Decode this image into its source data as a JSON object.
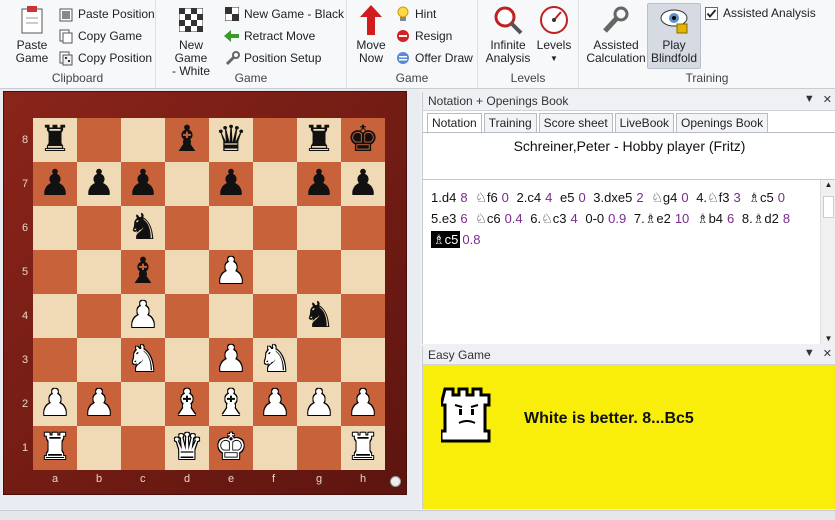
{
  "ribbon": {
    "clipboard": {
      "label": "Clipboard",
      "paste_game": "Paste\nGame",
      "paste_position": "Paste Position",
      "copy_game": "Copy Game",
      "copy_position": "Copy Position"
    },
    "game": {
      "label": "Game",
      "new_game_white": "New Game\n- White",
      "new_game_black": "New Game - Black",
      "retract_move": "Retract Move",
      "position_setup": "Position Setup"
    },
    "game2": {
      "label": "Game",
      "move_now": "Move\nNow",
      "hint": "Hint",
      "resign": "Resign",
      "offer_draw": "Offer Draw"
    },
    "levels": {
      "label": "Levels",
      "infinite_analysis": "Infinite\nAnalysis",
      "levels": "Levels"
    },
    "training": {
      "label": "Training",
      "assisted_calculation": "Assisted\nCalculation",
      "play_blindfold": "Play\nBlindfold",
      "assisted_analysis": "Assisted Analysis",
      "assisted_analysis_checked": true
    }
  },
  "board": {
    "files": [
      "a",
      "b",
      "c",
      "d",
      "e",
      "f",
      "g",
      "h"
    ],
    "ranks": [
      "8",
      "7",
      "6",
      "5",
      "4",
      "3",
      "2",
      "1"
    ],
    "rows": [
      [
        "bR",
        "",
        "",
        "bB",
        "bQ",
        "",
        "bR",
        "bK",
        ""
      ],
      [
        "bP",
        "bP",
        "bP",
        "",
        "bP",
        "",
        "bP",
        "bP",
        ""
      ],
      [
        "",
        "",
        "bN",
        "",
        "",
        "",
        "",
        ""
      ],
      [
        "",
        "",
        "bB",
        "",
        "wP",
        "",
        "",
        ""
      ],
      [
        "",
        "",
        "wP",
        "",
        "",
        "",
        "bN",
        ""
      ],
      [
        "",
        "",
        "wN",
        "",
        "wP",
        "wN",
        "",
        ""
      ],
      [
        "wP",
        "wP",
        "",
        "wB",
        "wB",
        "wP",
        "wP",
        "wP"
      ],
      [
        "wR",
        "",
        "",
        "wQ",
        "wK",
        "",
        "",
        "wR"
      ]
    ]
  },
  "notation": {
    "title": "Notation + Openings Book",
    "tabs": [
      "Notation",
      "Training",
      "Score sheet",
      "LiveBook",
      "Openings Book"
    ],
    "active_tab": "Notation",
    "game_header": "Schreiner,Peter - Hobby player (Fritz)",
    "moves": [
      {
        "m": "1.d4",
        "e": "8"
      },
      {
        "m": "♘f6",
        "e": "0"
      },
      {
        "m": "2.c4",
        "e": "4"
      },
      {
        "m": "e5",
        "e": "0"
      },
      {
        "m": "3.dxe5",
        "e": "2"
      },
      {
        "m": "♘g4",
        "e": "0"
      },
      {
        "m": "4.♘f3",
        "e": "3"
      },
      {
        "m": "♗c5",
        "e": "0"
      },
      {
        "m": "5.e3",
        "e": "6"
      },
      {
        "m": "♘c6",
        "e": "0.4"
      },
      {
        "m": "6.♘c3",
        "e": "4"
      },
      {
        "m": "0-0",
        "e": "0.9"
      },
      {
        "m": "7.♗e2",
        "e": "10"
      },
      {
        "m": "♗b4",
        "e": "6"
      },
      {
        "m": "8.♗d2",
        "e": "8"
      },
      {
        "m": "♗c5",
        "e": "0.8",
        "current": true
      }
    ]
  },
  "easy_game": {
    "title": "Easy Game",
    "message": "White is better.  8...Bc5"
  },
  "colors": {
    "light_square": "#f0d9b5",
    "dark_square": "#c8623a",
    "easy_bg": "#f8ee0a",
    "eval_purple": "#7b2a8c"
  }
}
